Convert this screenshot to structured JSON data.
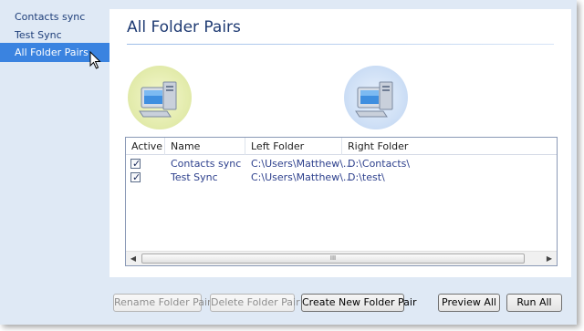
{
  "sidebar": {
    "items": [
      {
        "label": "Contacts sync"
      },
      {
        "label": "Test Sync"
      },
      {
        "label": "All Folder Pairs",
        "selected": true
      }
    ]
  },
  "main": {
    "title": "All Folder Pairs",
    "left_computer_icon": "computer-icon",
    "right_computer_icon": "computer-icon"
  },
  "list": {
    "columns": [
      "Active",
      "Name",
      "Left Folder",
      "Right Folder"
    ],
    "rows": [
      {
        "active": true,
        "name": "Contacts sync",
        "left": "C:\\Users\\Matthew\\...",
        "right": "D:\\Contacts\\"
      },
      {
        "active": true,
        "name": "Test Sync",
        "left": "C:\\Users\\Matthew\\...",
        "right": "D:\\test\\"
      }
    ],
    "scroll_thumb_grip": "III"
  },
  "buttons": {
    "rename": "Rename Folder Pair",
    "delete": "Delete Folder Pair",
    "create": "Create New Folder Pair",
    "preview": "Preview All",
    "run": "Run All"
  },
  "colors": {
    "sidebar_bg": "#dfe9f5",
    "selected_bg": "#3a83e0",
    "title": "#1f3b73"
  }
}
